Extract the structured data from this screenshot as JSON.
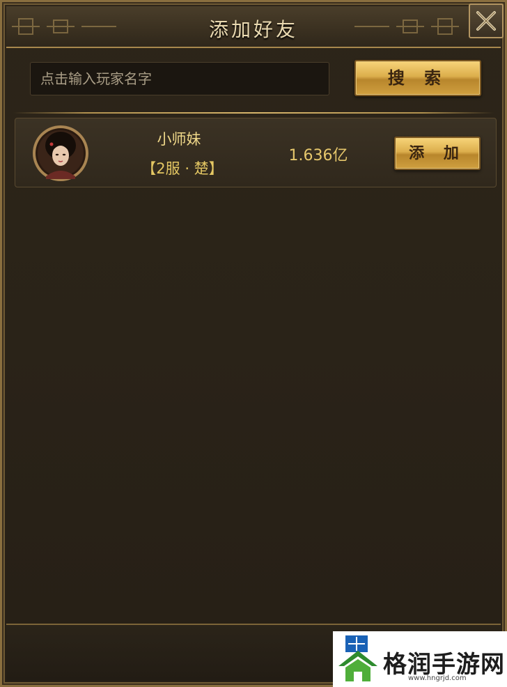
{
  "dialog": {
    "title": "添加好友",
    "close_icon": "close-x-icon"
  },
  "search": {
    "placeholder": "点击输入玩家名字",
    "value": "",
    "button_label": "搜 索"
  },
  "results": [
    {
      "name": "小师妹",
      "server": "【2服 · 楚】",
      "power": "1.636亿",
      "add_label": "添 加",
      "avatar_icon": "female-portrait-avatar"
    }
  ],
  "watermark": {
    "text": "格润手游网",
    "url": "www.hngrjd.com"
  },
  "colors": {
    "accent_gold": "#d9a441",
    "panel_bg": "#2a2318",
    "title_text": "#e9d9b0"
  }
}
